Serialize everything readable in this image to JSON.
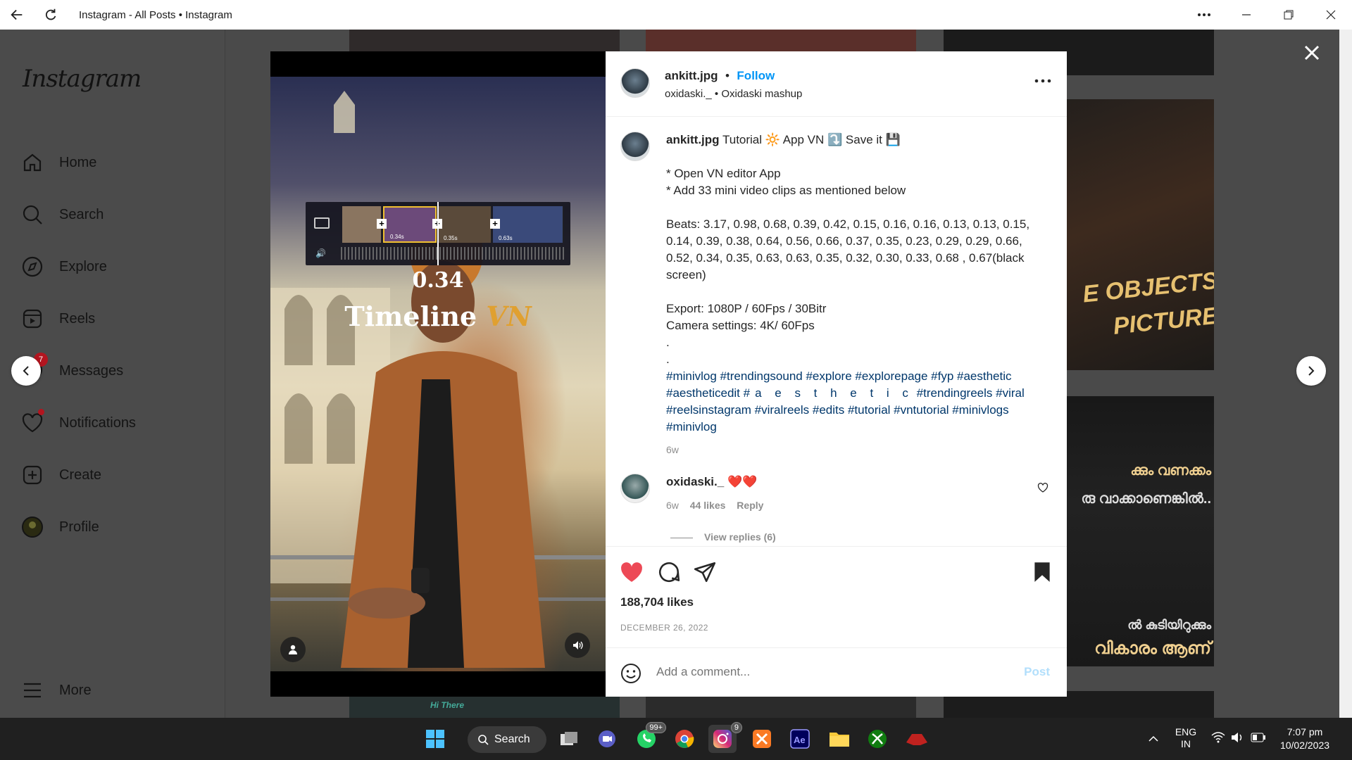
{
  "window": {
    "title": "Instagram - All Posts • Instagram"
  },
  "sidebar": {
    "logo": "Instagram",
    "items": [
      {
        "label": "Home"
      },
      {
        "label": "Search"
      },
      {
        "label": "Explore"
      },
      {
        "label": "Reels"
      },
      {
        "label": "Messages",
        "badge": "7"
      },
      {
        "label": "Notifications"
      },
      {
        "label": "Create"
      },
      {
        "label": "Profile"
      },
      {
        "label": "More"
      }
    ]
  },
  "media": {
    "timeline_clip_a": "0.34s",
    "timeline_clip_b": "0.35s",
    "timeline_clip_c": "0.63s",
    "overlay_number": "0.34",
    "overlay_title": "Timeline",
    "overlay_title_accent": "VN"
  },
  "post": {
    "author": "ankitt.jpg",
    "dot": "•",
    "follow_label": "Follow",
    "audio_user": "oxidaski._",
    "audio_track": "Oxidaski mashup",
    "caption_title": "Tutorial 🔆 App VN ⤵️ Save it 💾",
    "caption_lines": [
      "* Open VN editor App",
      "* Add 33 mini video clips as mentioned below",
      "",
      "Beats: 3.17, 0.98, 0.68, 0.39, 0.42, 0.15, 0.16, 0.16, 0.13, 0.13, 0.15, 0.14, 0.39, 0.38, 0.64, 0.56, 0.66, 0.37, 0.35, 0.23, 0.29, 0.29, 0.66, 0.52, 0.34, 0.35, 0.63, 0.63, 0.35, 0.32, 0.30, 0.33, 0.68 , 0.67(black screen)",
      "",
      "Export: 1080P / 60Fps / 30Bitr",
      "Camera settings: 4K/ 60Fps",
      ".",
      "."
    ],
    "hashtags_1": "#minivlog #trendingsound #explore #explorepage #fyp #aesthetic #aestheticedit",
    "hashtags_spaced": "#a e s t h e t i c",
    "hashtags_2": "#trendingreels #viral #reelsinstagram #viralreels #edits #tutorial #vntutorial #minivlogs #minivlog",
    "caption_age": "6w",
    "comment": {
      "user": "oxidaski._",
      "text": "❤️❤️",
      "age": "6w",
      "likes": "44 likes",
      "reply": "Reply",
      "view_replies": "View replies (6)"
    },
    "likes": "188,704 likes",
    "date": "DECEMBER 26, 2022",
    "comment_placeholder": "Add a comment...",
    "post_label": "Post"
  },
  "background_tiles": {
    "tile_text_1": "E OBJECTS",
    "tile_text_2": "PICTURE",
    "tile_text_3": "ക്കും വണക്കം",
    "tile_text_4": "രു വാക്കാണെങ്കിൽ..",
    "tile_text_5": "ൽ കുടിയിറുക്കും",
    "tile_text_6": "വികാരം ആണ്",
    "tile_text_7": "Hi There"
  },
  "taskbar": {
    "search_label": "Search",
    "whatsapp_badge": "99+",
    "instagram_badge": "9",
    "lang_1": "ENG",
    "lang_2": "IN",
    "time": "7:07 pm",
    "date": "10/02/2023"
  },
  "colors": {
    "accent": "#0095f6",
    "heart": "#ed4956",
    "hashtag": "#00376b"
  }
}
